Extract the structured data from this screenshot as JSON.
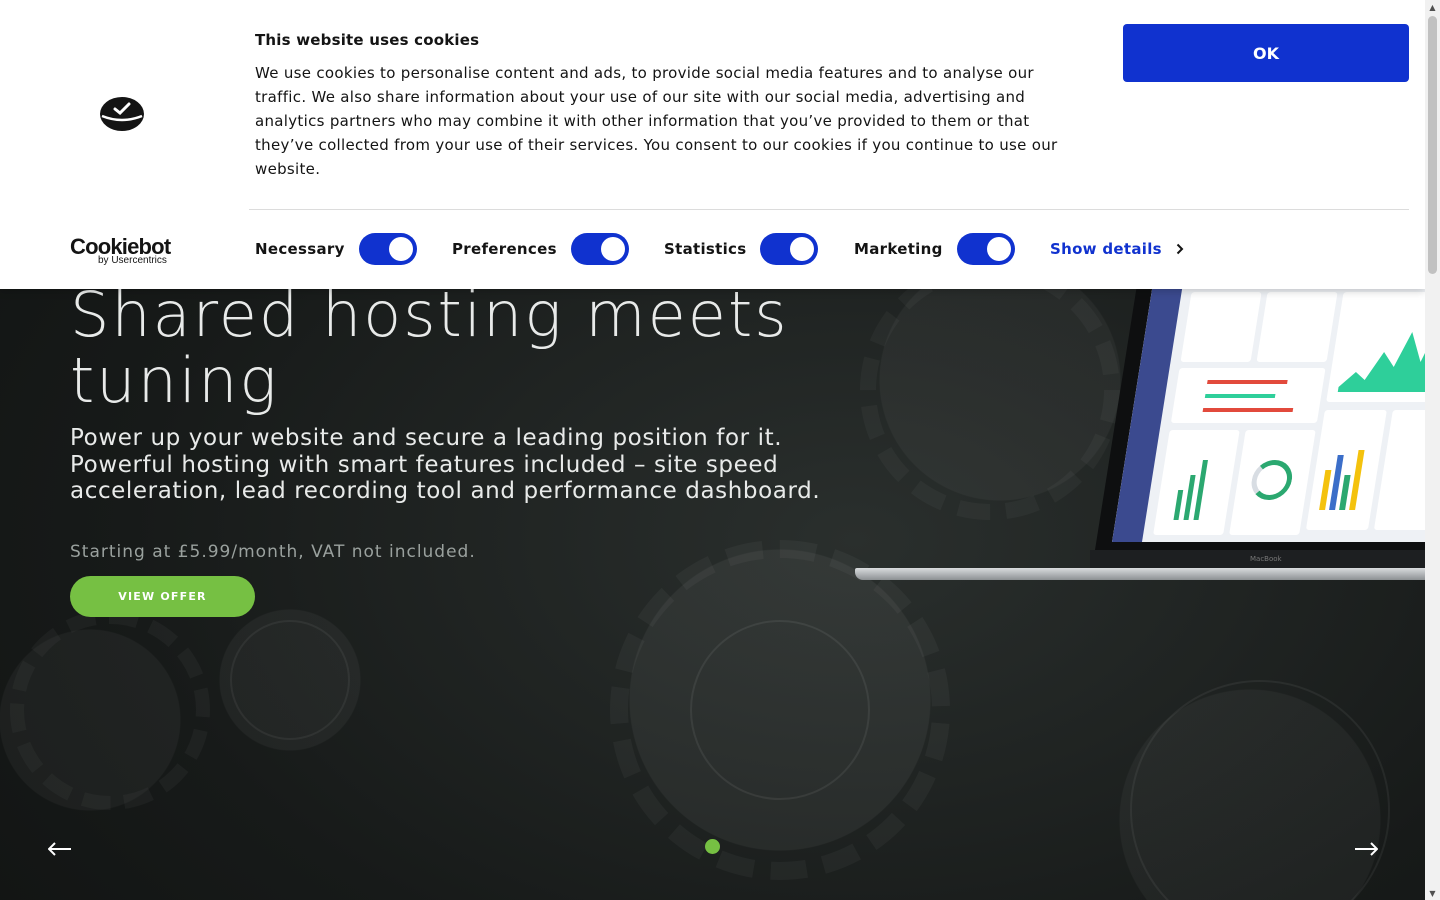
{
  "cookie_banner": {
    "title": "This website uses cookies",
    "text": "We use cookies to personalise content and ads, to provide social media features and to analyse our traffic. We also share information about your use of our site with our social media, advertising and analytics partners who may combine it with other information that you’ve provided to them or that they’ve collected from your use of their services. You consent to our cookies if you continue to use our website.",
    "ok_label": "OK",
    "brand_name": "Cookiebot",
    "brand_sub": "by Usercentrics",
    "toggles": [
      {
        "label": "Necessary",
        "checked": true
      },
      {
        "label": "Preferences",
        "checked": true
      },
      {
        "label": "Statistics",
        "checked": true
      },
      {
        "label": "Marketing",
        "checked": true
      }
    ],
    "show_details_label": "Show details",
    "accent_color": "#1032cf"
  },
  "hero": {
    "title": "Shared hosting meets tuning",
    "description": "Power up your website and secure a leading position for it. Powerful hosting with smart features included – site speed acceleration, lead recording tool and performance dashboard.",
    "price": "Starting at £5.99/month, VAT not included.",
    "cta_label": "VIEW OFFER",
    "cta_color": "#76c043",
    "laptop_brand": "MacBook",
    "carousel": {
      "slides": 1,
      "active": 1,
      "prev_icon": "arrow-left-icon",
      "next_icon": "arrow-right-icon"
    }
  }
}
